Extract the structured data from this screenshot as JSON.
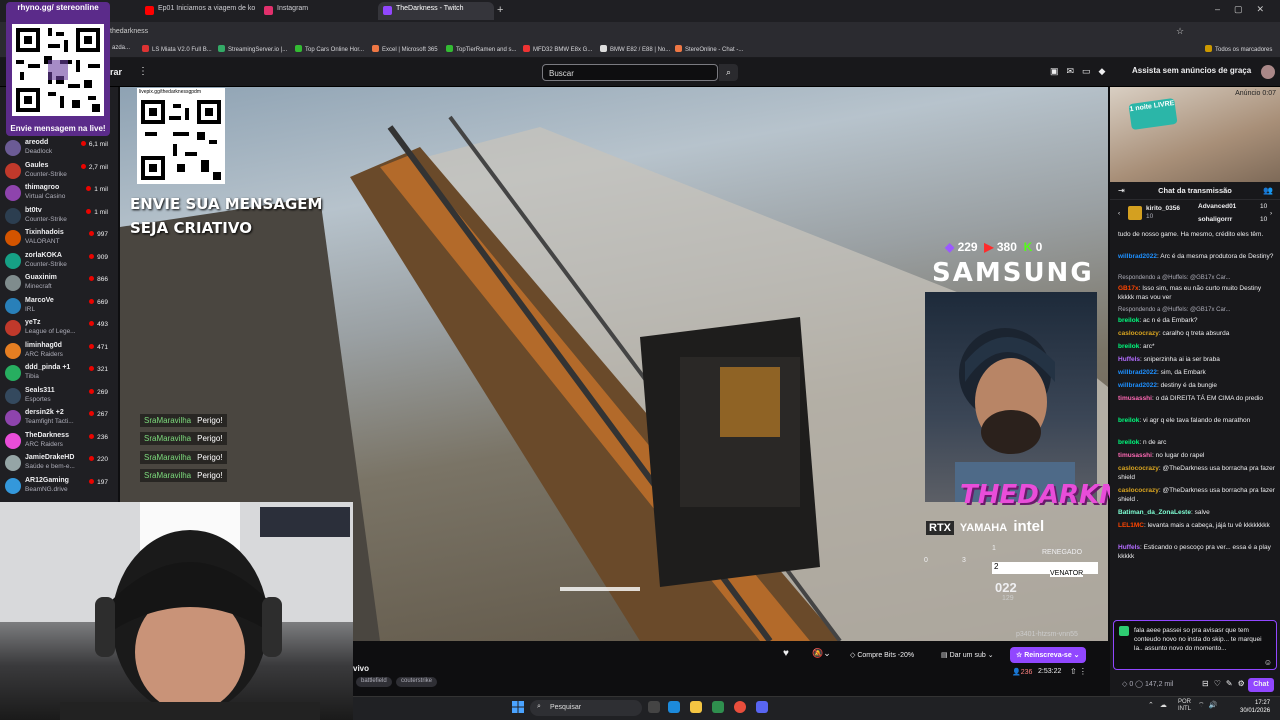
{
  "browser": {
    "tabs": [
      {
        "label": "",
        "color": "#e83e8c"
      },
      {
        "label": "Ep01 Iniciamos a viagem de ko",
        "color": "#ff0000"
      },
      {
        "label": "Instagram",
        "color": "#e1306c"
      },
      {
        "label": "TheDarkness - Twitch",
        "color": "#9147ff"
      }
    ],
    "url": "thedarkness",
    "bookmarks": [
      "azda...",
      "LS Miata V2.0 Full B...",
      "StreamingServer.io |...",
      "Top Cars Online Hor...",
      "Excel | Microsoft 365",
      "TopTierRamen and s...",
      "MFD32 BMW E8x G...",
      "BMW E82 / E88 | No...",
      "StereOnline - Chat -..."
    ],
    "bookmarks_all": "Todos os marcadores"
  },
  "overlay_qr": {
    "title": "rhyno.gg/ stereonline",
    "footer": "Envie mensagem na live!"
  },
  "twitch": {
    "nav_fragment": "rar",
    "search_placeholder": "Buscar",
    "turbo": "Assista sem anúncios de graça",
    "sidebar": [
      {
        "name": "areodd",
        "game": "Deadlock",
        "viewers": "6,1 mil",
        "color": "#6b5b95"
      },
      {
        "name": "Gaules",
        "game": "Counter-Strike",
        "viewers": "2,7 mil",
        "color": "#c0392b"
      },
      {
        "name": "thimagroo",
        "game": "Virtual Casino",
        "viewers": "1 mil",
        "color": "#8e44ad"
      },
      {
        "name": "bt0tv",
        "game": "Counter-Strike",
        "viewers": "1 mil",
        "color": "#2c3e50"
      },
      {
        "name": "Tixinhadois",
        "game": "VALORANT",
        "viewers": "997",
        "color": "#d35400"
      },
      {
        "name": "zorlaKOKA",
        "game": "Counter-Strike",
        "viewers": "909",
        "color": "#16a085"
      },
      {
        "name": "Guaxinim",
        "game": "Minecraft",
        "viewers": "866",
        "color": "#7f8c8d"
      },
      {
        "name": "MarcoVe",
        "game": "IRL",
        "viewers": "669",
        "color": "#2980b9"
      },
      {
        "name": "yeTz",
        "game": "League of Lege...",
        "viewers": "493",
        "color": "#c0392b"
      },
      {
        "name": "liminhag0d",
        "game": "ARC Raiders",
        "viewers": "471",
        "color": "#e67e22"
      },
      {
        "name": "ddd_pinda +1",
        "game": "Tibia",
        "viewers": "321",
        "color": "#27ae60"
      },
      {
        "name": "Seals311",
        "game": "Esportes",
        "viewers": "269",
        "color": "#34495e"
      },
      {
        "name": "dersin2k +2",
        "game": "Teamfight Tacti...",
        "viewers": "267",
        "color": "#8e44ad"
      },
      {
        "name": "TheDarkness",
        "game": "ARC Raiders",
        "viewers": "236",
        "color": "#e94dd9"
      },
      {
        "name": "JamieDrakeHD",
        "game": "Saúde e bem-e...",
        "viewers": "220",
        "color": "#95a5a6"
      },
      {
        "name": "AR12Gaming",
        "game": "BeamNG.drive",
        "viewers": "197",
        "color": "#3498db"
      }
    ]
  },
  "stream": {
    "overlay_url": "livepix.gg/thedarknessgpdm",
    "overlay_text": [
      "ENVIE SUA MENSAGEM",
      "SEJA CRIATIVO"
    ],
    "killfeed": [
      {
        "who": "SraMaravilha",
        "what": "Perigo!"
      },
      {
        "who": "SraMaravilha",
        "what": "Perigo!"
      },
      {
        "who": "SraMaravilha",
        "what": "Perigo!"
      },
      {
        "who": "SraMaravilha",
        "what": "Perigo!"
      }
    ],
    "counters": {
      "a": "229",
      "b": "380",
      "c": "0"
    },
    "sponsor_main": "SAMSUNG",
    "streamer_logo": "THEDARKNESS",
    "sponsor_line": [
      "RTX",
      "YAMAHA",
      "intel"
    ],
    "hud": {
      "slot1": "1",
      "slot2": "2",
      "weapon1": "RENEGADO",
      "weapon2": "VENATOR",
      "ammo": "022",
      "reserve": "129",
      "q1": "0",
      "q2": "3"
    },
    "stream_id": "p3401-htzsm-vnn55",
    "title_fragment": "vivo",
    "tags": [
      "battlefield",
      "couterstrike"
    ],
    "bits": "Compre Bits -20%",
    "sub": "Dar um sub",
    "resub": "Reinscreva-se",
    "viewers": "236",
    "uptime": "2:53:22"
  },
  "ad": {
    "label": "Anúncio 0:07",
    "promo": "1 noite LIVRE"
  },
  "chat": {
    "title": "Chat da transmissão",
    "gifts": [
      {
        "user": "kirito_0356",
        "count": "10"
      },
      {
        "user": "Advanced01",
        "count": "10"
      },
      {
        "user": "sohaligorrr",
        "count": "10"
      }
    ],
    "messages": [
      {
        "user": "",
        "text": "tudo de nosso game. Ha mesmo, crédito eles têm.",
        "color": "#efeff1",
        "reply": ""
      },
      {
        "user": "willbrad2022",
        "text": "Arc é da mesma produtora de Destiny?",
        "color": "#1e90ff",
        "reply": ""
      },
      {
        "user": "GB17x",
        "text": "Isso sim, mas eu não curto muito Destiny kkkkk mas vou ver",
        "color": "#ff4500",
        "reply": "Respondendo a @Huffels: @GB17x Car..."
      },
      {
        "user": "breilok",
        "text": "ac n é da Embark?",
        "color": "#00ff7f",
        "reply": "Respondendo a @Huffels: @GB17x Car..."
      },
      {
        "user": "caslococrazy",
        "text": "caralho q treta absurda",
        "color": "#daa520",
        "reply": ""
      },
      {
        "user": "breilok",
        "text": "arc*",
        "color": "#00ff7f",
        "reply": ""
      },
      {
        "user": "Huffels",
        "text": "sniperzinha ai ia ser braba",
        "color": "#b36cff",
        "reply": ""
      },
      {
        "user": "willbrad2022",
        "text": "sim, da Embark",
        "color": "#1e90ff",
        "reply": ""
      },
      {
        "user": "willbrad2022",
        "text": "destiny é da bungie",
        "color": "#1e90ff",
        "reply": ""
      },
      {
        "user": "timusasshi",
        "text": "o dá DIREITA TÁ EM CIMA do predio",
        "color": "#ff69b4",
        "reply": ""
      },
      {
        "user": "breilok",
        "text": "vi agr q ele tava falando de marathon",
        "color": "#00ff7f",
        "reply": ""
      },
      {
        "user": "breilok",
        "text": "n de arc",
        "color": "#00ff7f",
        "reply": ""
      },
      {
        "user": "timusasshi",
        "text": "no lugar do rapel",
        "color": "#ff69b4",
        "reply": ""
      },
      {
        "user": "caslococrazy",
        "text": "@TheDarkness usa borracha pra fazer shield",
        "color": "#daa520",
        "reply": ""
      },
      {
        "user": "caslococrazy",
        "text": "@TheDarkness usa borracha pra fazer shield .",
        "color": "#daa520",
        "reply": ""
      },
      {
        "user": "Batiman_da_ZonaLeste",
        "text": "salve",
        "color": "#7fffd4",
        "reply": ""
      },
      {
        "user": "LEL1MC",
        "text": "levanta mais a cabeça, jájá tu vê kkkkkkkk",
        "color": "#ff4500",
        "reply": ""
      },
      {
        "user": "Huffels",
        "text": "Esticando o pescoço pra ver... essa é a play kkkkk",
        "color": "#b36cff",
        "reply": ""
      }
    ],
    "input_text": "fala aeee passei so pra avisasr que tem conteudo novo no insta do skip... te marquei la.. assunto novo do momento...",
    "points": "147,2 mil",
    "points_num": "0",
    "send": "Chat"
  },
  "taskbar": {
    "search": "Pesquisar",
    "lang": "POR INTL",
    "time": "17:27",
    "date": "30/01/2026"
  }
}
